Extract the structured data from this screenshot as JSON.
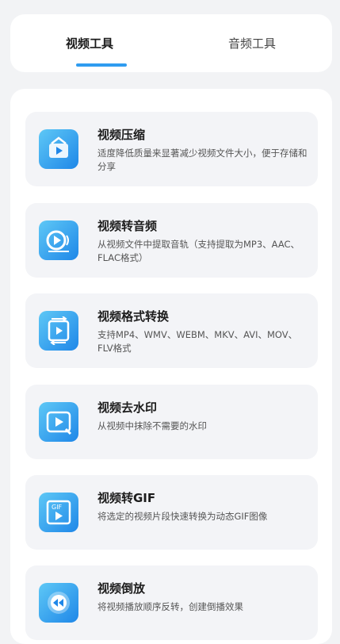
{
  "tabs": [
    {
      "label": "视频工具",
      "active": true
    },
    {
      "label": "音频工具",
      "active": false
    }
  ],
  "accent_color": "#2f9cf0",
  "tools": [
    {
      "title": "视频压缩",
      "desc": "适度降低质量来显著减少视频文件大小，便于存储和分享",
      "icon": "compress-icon"
    },
    {
      "title": "视频转音频",
      "desc": "从视频文件中提取音轨（支持提取为MP3、AAC、FLAC格式）",
      "icon": "video-to-audio-icon"
    },
    {
      "title": "视频格式转换",
      "desc": "支持MP4、WMV、WEBM、MKV、AVI、MOV、FLV格式",
      "icon": "convert-icon"
    },
    {
      "title": "视频去水印",
      "desc": "从视频中抹除不需要的水印",
      "icon": "watermark-remove-icon"
    },
    {
      "title": "视频转GIF",
      "desc": "将选定的视频片段快速转换为动态GIF图像",
      "icon": "gif-icon",
      "icon_text": "GIF"
    },
    {
      "title": "视频倒放",
      "desc": "将视频播放顺序反转，创建倒播效果",
      "icon": "reverse-icon"
    }
  ]
}
